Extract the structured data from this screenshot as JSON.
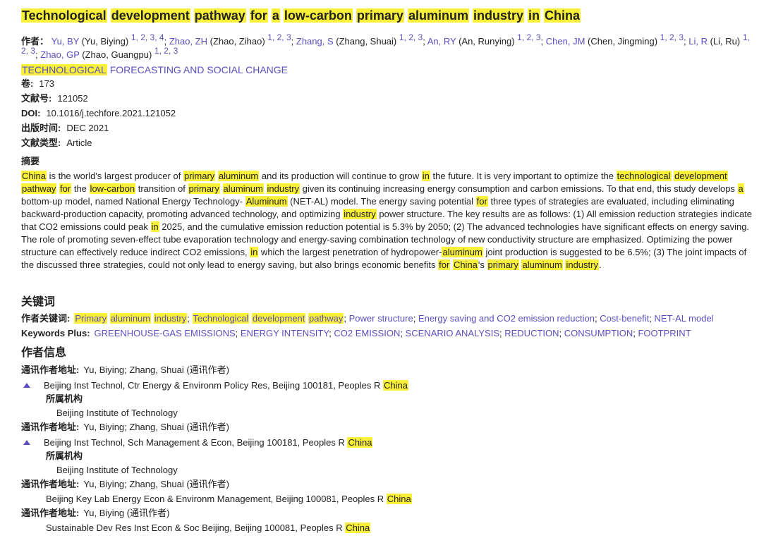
{
  "article": {
    "title_parts": [
      {
        "t": "Technological",
        "hl": true
      },
      {
        "t": " ",
        "hl": false
      },
      {
        "t": "development",
        "hl": true
      },
      {
        "t": " ",
        "hl": false
      },
      {
        "t": "pathway",
        "hl": true
      },
      {
        "t": " ",
        "hl": false
      },
      {
        "t": "for",
        "hl": true
      },
      {
        "t": " ",
        "hl": false
      },
      {
        "t": "a",
        "hl": true
      },
      {
        "t": " ",
        "hl": false
      },
      {
        "t": "low-carbon",
        "hl": true
      },
      {
        "t": " ",
        "hl": false
      },
      {
        "t": "primary",
        "hl": true
      },
      {
        "t": " ",
        "hl": false
      },
      {
        "t": "aluminum",
        "hl": true
      },
      {
        "t": " ",
        "hl": false
      },
      {
        "t": "industry",
        "hl": true
      },
      {
        "t": " ",
        "hl": false
      },
      {
        "t": "in",
        "hl": true
      },
      {
        "t": " ",
        "hl": false
      },
      {
        "t": "China",
        "hl": true
      }
    ]
  },
  "authors": {
    "label": "作者：",
    "list": [
      {
        "short": "Yu, BY",
        "full": "(Yu, Biying)",
        "aff": "1, 2, 3, 4",
        "sep": ";"
      },
      {
        "short": "Zhao, ZH",
        "full": "(Zhao, Zihao)",
        "aff": "1, 2, 3",
        "sep": ";"
      },
      {
        "short": "Zhang, S",
        "full": "(Zhang, Shuai)",
        "aff": "1, 2, 3",
        "sep": ";"
      },
      {
        "short": "An, RY",
        "full": "(An, Runying)",
        "aff": "1, 2, 3",
        "sep": ";"
      },
      {
        "short": "Chen, JM",
        "full": "(Chen, Jingming)",
        "aff": "1, 2, 3",
        "sep": ";"
      },
      {
        "short": "Li, R",
        "full": "(Li, Ru)",
        "aff": "1, 2, 3",
        "sep": ";"
      },
      {
        "short": "Zhao, GP",
        "full": "(Zhao, Guangpu)",
        "aff": "1, 2, 3",
        "sep": ""
      }
    ]
  },
  "journal": {
    "parts": [
      {
        "t": "TECHNOLOGICAL",
        "hl": true
      },
      {
        "t": " FORECASTING AND SOCIAL CHANGE",
        "hl": false
      }
    ]
  },
  "meta": [
    {
      "label": "卷:",
      "value": "173"
    },
    {
      "label": "文献号:",
      "value": "121052"
    },
    {
      "label": "DOI:",
      "value": "10.1016/j.techfore.2021.121052"
    },
    {
      "label": "出版时间:",
      "value": "DEC 2021"
    },
    {
      "label": "文献类型:",
      "value": "Article"
    }
  ],
  "abstract": {
    "heading": "摘要",
    "parts": [
      {
        "t": "China",
        "hl": true
      },
      {
        "t": " is the world's largest producer of ",
        "hl": false
      },
      {
        "t": "primary",
        "hl": true
      },
      {
        "t": " ",
        "hl": false
      },
      {
        "t": "aluminum",
        "hl": true
      },
      {
        "t": " and its production will continue to grow ",
        "hl": false
      },
      {
        "t": "in",
        "hl": true
      },
      {
        "t": " the future. It is very important to optimize the ",
        "hl": false
      },
      {
        "t": "technological",
        "hl": true
      },
      {
        "t": " ",
        "hl": false
      },
      {
        "t": "development",
        "hl": true
      },
      {
        "t": " ",
        "hl": false
      },
      {
        "t": "pathway",
        "hl": true
      },
      {
        "t": " ",
        "hl": false
      },
      {
        "t": "for",
        "hl": true
      },
      {
        "t": " the ",
        "hl": false
      },
      {
        "t": "low-carbon",
        "hl": true
      },
      {
        "t": " transition of ",
        "hl": false
      },
      {
        "t": "primary",
        "hl": true
      },
      {
        "t": " ",
        "hl": false
      },
      {
        "t": "aluminum",
        "hl": true
      },
      {
        "t": " ",
        "hl": false
      },
      {
        "t": "industry",
        "hl": true
      },
      {
        "t": " given its continuing increasing energy consumption and carbon emissions. To that end, this study develops ",
        "hl": false
      },
      {
        "t": "a",
        "hl": true
      },
      {
        "t": " bottom-up model, named National Energy Technology- ",
        "hl": false
      },
      {
        "t": "Aluminum",
        "hl": true
      },
      {
        "t": " (NET-AL) model. The energy saving potential ",
        "hl": false
      },
      {
        "t": "for",
        "hl": true
      },
      {
        "t": " three types of strategies are evaluated, including eliminating backward-production capacity, promoting advanced technology, and optimizing ",
        "hl": false
      },
      {
        "t": "industry",
        "hl": true
      },
      {
        "t": " power structure. The key results are as follows: (1) All emission reduction strategies indicate that CO2 emissions could peak ",
        "hl": false
      },
      {
        "t": "in",
        "hl": true
      },
      {
        "t": " 2025, and the cumulative emission reduction potential is 5.3% by 2050; (2) The advanced technologies have significant effects on energy saving. The role of promoting seven-effect tube evaporation technology and energy-saving combination technology of new conductivity structure are emphasized. Optimizing the power structure can effectively reduce indirect CO2 emissions, ",
        "hl": false
      },
      {
        "t": "in",
        "hl": true
      },
      {
        "t": " which the largest penetration of hydropower-",
        "hl": false
      },
      {
        "t": "aluminum",
        "hl": true
      },
      {
        "t": " joint production is suggested to be 6.5%; (3) The joint impacts of the discussed three strategies, could not only lead to energy saving, but also brings economic benefits ",
        "hl": false
      },
      {
        "t": "for",
        "hl": true
      },
      {
        "t": " ",
        "hl": false
      },
      {
        "t": "China",
        "hl": true
      },
      {
        "t": "'s ",
        "hl": false
      },
      {
        "t": "primary",
        "hl": true
      },
      {
        "t": " ",
        "hl": false
      },
      {
        "t": "aluminum",
        "hl": true
      },
      {
        "t": " ",
        "hl": false
      },
      {
        "t": "industry",
        "hl": true
      },
      {
        "t": ".",
        "hl": false
      }
    ]
  },
  "keywords": {
    "heading": "关键词",
    "author_label": "作者关键词:",
    "author_keywords": [
      [
        {
          "t": "Primary",
          "hl": true
        },
        {
          "t": " ",
          "hl": false
        },
        {
          "t": "aluminum",
          "hl": true
        },
        {
          "t": " ",
          "hl": false
        },
        {
          "t": "industry",
          "hl": true
        }
      ],
      [
        {
          "t": "Technological",
          "hl": true
        },
        {
          "t": " ",
          "hl": false
        },
        {
          "t": "development",
          "hl": true
        },
        {
          "t": " ",
          "hl": false
        },
        {
          "t": "pathway",
          "hl": true
        }
      ],
      [
        {
          "t": "Power structure",
          "hl": false
        }
      ],
      [
        {
          "t": "Energy saving and CO2 emission reduction",
          "hl": false
        }
      ],
      [
        {
          "t": "Cost-benefit",
          "hl": false
        }
      ],
      [
        {
          "t": "NET-AL model",
          "hl": false
        }
      ]
    ],
    "plus_label": "Keywords Plus:",
    "plus_keywords": [
      "GREENHOUSE-GAS EMISSIONS",
      "ENERGY INTENSITY",
      "CO2 EMISSION",
      "SCENARIO ANALYSIS",
      "REDUCTION",
      "CONSUMPTION",
      "FOOTPRINT"
    ]
  },
  "author_info": {
    "heading": "作者信息",
    "blocks": [
      {
        "label": "通讯作者地址:",
        "names": "Yu, Biying; Zhang, Shuai",
        "role": "(通讯作者)",
        "address": "Beijing Inst Technol, Ctr Energy & Environm Policy Res, Beijing 100181, Peoples R ",
        "country": "China",
        "expandable": true,
        "org_label": "所属机构",
        "org": "Beijing Institute of Technology"
      },
      {
        "label": "通讯作者地址:",
        "names": "Yu, Biying; Zhang, Shuai",
        "role": "(通讯作者)",
        "address": "Beijing Inst Technol, Sch Management & Econ, Beijing 100181, Peoples R ",
        "country": "China",
        "expandable": true,
        "org_label": "所属机构",
        "org": "Beijing Institute of Technology"
      },
      {
        "label": "通讯作者地址:",
        "names": "Yu, Biying; Zhang, Shuai",
        "role": "(通讯作者)",
        "address": "Beijing Key Lab Energy Econ & Environm Management, Beijing 100081, Peoples R ",
        "country": "China",
        "expandable": false
      },
      {
        "label": "通讯作者地址:",
        "names": "Yu, Biying",
        "role": "(通讯作者)",
        "address": "Sustainable Dev Res Inst Econ & Soc Beijing, Beijing 100081, Peoples R ",
        "country": "China",
        "expandable": false
      }
    ]
  },
  "colors": {
    "highlight": "#f9f03a",
    "link": "#5a4fbf",
    "text": "#222222"
  }
}
